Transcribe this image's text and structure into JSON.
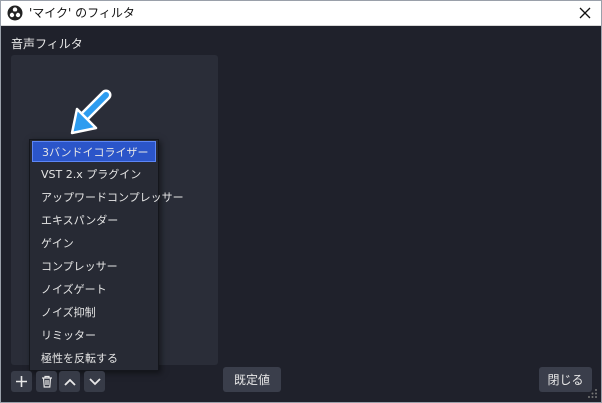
{
  "window": {
    "title": "'マイク' のフィルタ"
  },
  "section": {
    "audio_filters_label": "音声フィルタ"
  },
  "menu": {
    "items": [
      "3バンドイコライザー",
      "VST 2.x プラグイン",
      "アップワードコンプレッサー",
      "エキスパンダー",
      "ゲイン",
      "コンプレッサー",
      "ノイズゲート",
      "ノイズ抑制",
      "リミッター",
      "極性を反転する"
    ],
    "selected_index": 0
  },
  "buttons": {
    "defaults_label": "既定値",
    "close_label": "閉じる"
  },
  "colors": {
    "accent": "#2b55c9",
    "pointer_arrow": "#2d9cf0",
    "background": "#1f212b"
  }
}
